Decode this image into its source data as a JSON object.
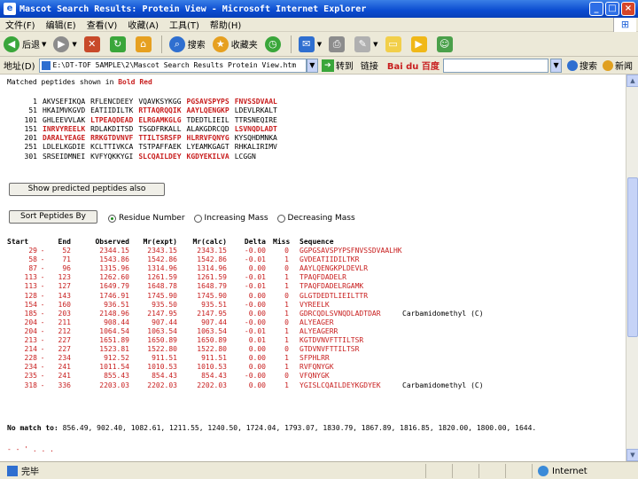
{
  "window": {
    "title": "Mascot Search Results: Protein View - Microsoft Internet Explorer",
    "buttons": {
      "minimize": "_",
      "maximize": "□",
      "close": "×"
    }
  },
  "menu": [
    "文件(F)",
    "编辑(E)",
    "查看(V)",
    "收藏(A)",
    "工具(T)",
    "帮助(H)"
  ],
  "toolbar": {
    "back": "后退",
    "search": "搜索",
    "favorites": "收藏夹"
  },
  "address": {
    "label": "地址(D)",
    "url": "E:\\DT-TOF 5AMPLE\\2\\Mascot Search Results Protein View.htm",
    "go": "转到",
    "links": "链接",
    "baidu": "Bai du 百度",
    "search_btn": "搜索",
    "search_btn2": "新闻"
  },
  "content": {
    "matched_prefix": "Matched peptides shown in ",
    "matched_red": "Bold Red",
    "sequence_rows": [
      {
        "pos": "1",
        "chunks": [
          "AKVSEFIKQA",
          "RFLENCDEEY",
          "VQAVKSYKGG",
          "PGSAVSPYPS",
          "FNVSSDVAAL"
        ]
      },
      {
        "pos": "51",
        "chunks": [
          "HKAIMVKGVD",
          "EATIIDILTK",
          "RTTAQRQQIK",
          "AAYLQENGKP",
          "LDEVLRKALT"
        ]
      },
      {
        "pos": "101",
        "chunks": [
          "GHLEEVVLAK",
          "LTPEAQDEAD",
          "ELRGAMKGLG",
          "TDEDTLIEIL",
          "TTRSNEQIRE"
        ]
      },
      {
        "pos": "151",
        "chunks": [
          "INRVYREELK",
          "RDLAKDITSD",
          "TSGDFRKALL",
          "ALAKGDRCQD",
          "LSVNQDLADT"
        ]
      },
      {
        "pos": "201",
        "chunks": [
          "DARALYEAGE",
          "RRKGTDVNVF",
          "TTILTSRSFP",
          "HLRRVFQNYG",
          "KYSQHDMNKA"
        ]
      },
      {
        "pos": "251",
        "chunks": [
          "LDLELKGDIE",
          "KCLTTIVKCA",
          "TSTPAFFAEK",
          "LYEAMKGAGT",
          "RHKALIRIMV"
        ]
      },
      {
        "pos": "301",
        "chunks": [
          "SRSEIDMNEI",
          "KVFYQKKYGI",
          "SLCQAILDEY",
          "KGDYEKILVA",
          "LCGGN"
        ]
      }
    ],
    "show_predicted_btn": "Show predicted peptides also",
    "sort_btn": "Sort Peptides By",
    "radios": [
      {
        "label": "Residue Number",
        "checked": true
      },
      {
        "label": "Increasing Mass",
        "checked": false
      },
      {
        "label": "Decreasing Mass",
        "checked": false
      }
    ],
    "table_headers": {
      "start": "Start",
      "end": "End",
      "observed": "Observed",
      "mr_expt": "Mr(expt)",
      "mr_calc": "Mr(calc)",
      "delta": "Delta",
      "miss": "Miss",
      "sequence": "Sequence"
    },
    "table_rows": [
      {
        "start": "29",
        "end": "52",
        "obs": "2344.15",
        "expt": "2343.15",
        "calc": "2343.15",
        "delta": "-0.00",
        "miss": "0",
        "seq": "GGPGSAVSPYPSFNVSSDVAALHK",
        "mod": ""
      },
      {
        "start": "58",
        "end": "71",
        "obs": "1543.86",
        "expt": "1542.86",
        "calc": "1542.86",
        "delta": "-0.01",
        "miss": "1",
        "seq": "GVDEATIIDILTKR",
        "mod": ""
      },
      {
        "start": "87",
        "end": "96",
        "obs": "1315.96",
        "expt": "1314.96",
        "calc": "1314.96",
        "delta": "0.00",
        "miss": "0",
        "seq": "AAYLQENGKPLDEVLR",
        "mod": ""
      },
      {
        "start": "113",
        "end": "123",
        "obs": "1262.60",
        "expt": "1261.59",
        "calc": "1261.59",
        "delta": "-0.01",
        "miss": "1",
        "seq": "TPAQFDADELR",
        "mod": ""
      },
      {
        "start": "113",
        "end": "127",
        "obs": "1649.79",
        "expt": "1648.78",
        "calc": "1648.79",
        "delta": "-0.01",
        "miss": "1",
        "seq": "TPAQFDADELRGAMK",
        "mod": ""
      },
      {
        "start": "128",
        "end": "143",
        "obs": "1746.91",
        "expt": "1745.90",
        "calc": "1745.90",
        "delta": "0.00",
        "miss": "0",
        "seq": "GLGTDEDTLIEILTTR",
        "mod": ""
      },
      {
        "start": "154",
        "end": "160",
        "obs": "936.51",
        "expt": "935.50",
        "calc": "935.51",
        "delta": "-0.00",
        "miss": "1",
        "seq": "VYREELK",
        "mod": ""
      },
      {
        "start": "185",
        "end": "203",
        "obs": "2148.96",
        "expt": "2147.95",
        "calc": "2147.95",
        "delta": "0.00",
        "miss": "1",
        "seq": "GDRCQDLSVNQDLADTDAR",
        "mod": "Carbamidomethyl (C)"
      },
      {
        "start": "204",
        "end": "211",
        "obs": "908.44",
        "expt": "907.44",
        "calc": "907.44",
        "delta": "-0.00",
        "miss": "0",
        "seq": "ALYEAGER",
        "mod": ""
      },
      {
        "start": "204",
        "end": "212",
        "obs": "1064.54",
        "expt": "1063.54",
        "calc": "1063.54",
        "delta": "-0.01",
        "miss": "1",
        "seq": "ALYEAGERR",
        "mod": ""
      },
      {
        "start": "213",
        "end": "227",
        "obs": "1651.89",
        "expt": "1650.89",
        "calc": "1650.89",
        "delta": "0.01",
        "miss": "1",
        "seq": "KGTDVNVFTTILTSR",
        "mod": ""
      },
      {
        "start": "214",
        "end": "227",
        "obs": "1523.81",
        "expt": "1522.80",
        "calc": "1522.80",
        "delta": "0.00",
        "miss": "0",
        "seq": "GTDVNVFTTILTSR",
        "mod": ""
      },
      {
        "start": "228",
        "end": "234",
        "obs": "912.52",
        "expt": "911.51",
        "calc": "911.51",
        "delta": "0.00",
        "miss": "1",
        "seq": "SFPHLRR",
        "mod": ""
      },
      {
        "start": "234",
        "end": "241",
        "obs": "1011.54",
        "expt": "1010.53",
        "calc": "1010.53",
        "delta": "0.00",
        "miss": "1",
        "seq": "RVFQNYGK",
        "mod": ""
      },
      {
        "start": "235",
        "end": "241",
        "obs": "855.43",
        "expt": "854.43",
        "calc": "854.43",
        "delta": "-0.00",
        "miss": "0",
        "seq": "VFQNYGK",
        "mod": ""
      },
      {
        "start": "318",
        "end": "336",
        "obs": "2203.03",
        "expt": "2202.03",
        "calc": "2202.03",
        "delta": "0.00",
        "miss": "1",
        "seq": "YGISLCQAILDEYKGDYEK",
        "mod": "Carbamidomethyl (C)"
      }
    ],
    "no_match_label": "No match to:",
    "no_match_values": "856.49, 902.40, 1082.61, 1211.55, 1240.50, 1724.04, 1793.07, 1830.79, 1867.89, 1816.85, 1820.00, 1800.00, 1644.",
    "fragment": "- - ' . . ."
  },
  "status": {
    "text": "完毕",
    "zone": "Internet"
  },
  "colors": {
    "match_red": "#c81e1e",
    "titlebar_blue": "#0a4bd0",
    "chrome": "#ece9d8"
  }
}
